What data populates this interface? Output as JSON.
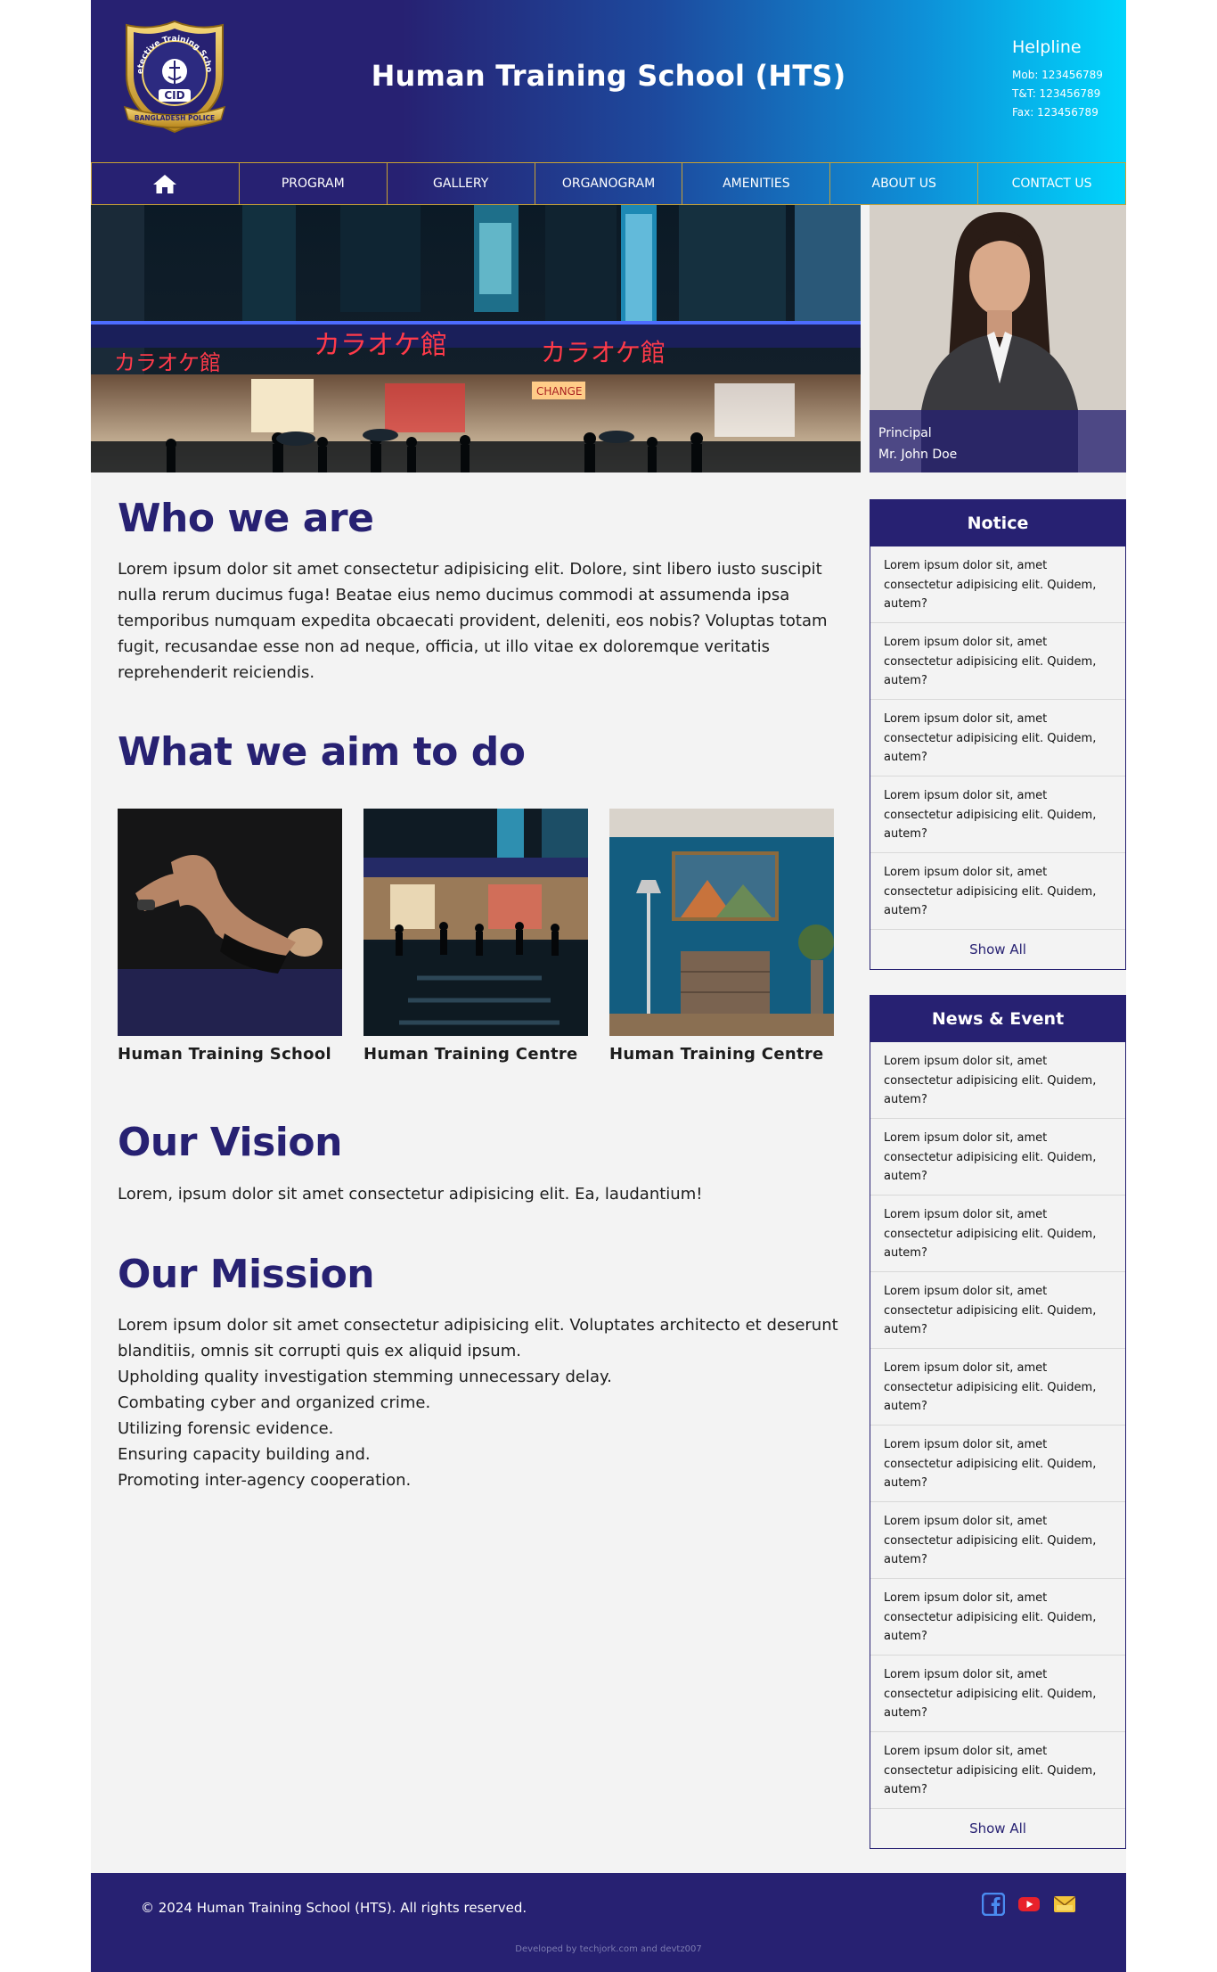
{
  "header": {
    "logo_text": [
      "Detective Training School",
      "CID",
      "BANGLADESH POLICE"
    ],
    "title": "Human Training School (HTS)",
    "helpline": {
      "title": "Helpline",
      "lines": [
        "Mob: 123456789",
        "T&T: 123456789",
        "Fax: 123456789"
      ]
    }
  },
  "nav": {
    "home_icon": "home-icon",
    "items": [
      "PROGRAM",
      "GALLERY",
      "ORGANOGRAM",
      "AMENITIES",
      "ABOUT US",
      "CONTACT US"
    ]
  },
  "hero": {
    "main_sign": [
      "カラオケ館",
      "カラオケ館",
      "カラオケ館",
      "CHANGE"
    ],
    "principal": {
      "role": "Principal",
      "name": "Mr. John Doe"
    }
  },
  "who": {
    "title": "Who we are",
    "text": "Lorem ipsum dolor sit amet consectetur adipisicing elit. Dolore, sint libero iusto suscipit nulla rerum ducimus fuga! Beatae eius nemo ducimus commodi at assumenda ipsa temporibus numquam expedita obcaecati provident, deleniti, eos nobis? Voluptas totam fugit, recusandae esse non ad neque, officia, ut illo vitae ex doloremque veritatis reprehenderit reiciendis."
  },
  "aim": {
    "title": "What we aim to do",
    "cards": [
      {
        "caption": "Human Training School"
      },
      {
        "caption": "Human Training Centre"
      },
      {
        "caption": "Human Training Centre"
      }
    ]
  },
  "vision": {
    "title": "Our Vision",
    "text": "Lorem, ipsum dolor sit amet consectetur adipisicing elit. Ea, laudantium!"
  },
  "mission": {
    "title": "Our Mission",
    "lines": [
      "Lorem ipsum dolor sit amet consectetur adipisicing elit. Voluptates architecto et deserunt blanditiis, omnis sit corrupti quis ex aliquid ipsum.",
      "Upholding quality investigation stemming unnecessary delay.",
      "Combating cyber and organized crime.",
      "Utilizing forensic evidence.",
      "Ensuring capacity building and.",
      "Promoting inter-agency cooperation."
    ]
  },
  "notice": {
    "title": "Notice",
    "items": [
      "Lorem ipsum dolor sit, amet consectetur adipisicing elit. Quidem, autem?",
      "Lorem ipsum dolor sit, amet consectetur adipisicing elit. Quidem, autem?",
      "Lorem ipsum dolor sit, amet consectetur adipisicing elit. Quidem, autem?",
      "Lorem ipsum dolor sit, amet consectetur adipisicing elit. Quidem, autem?",
      "Lorem ipsum dolor sit, amet consectetur adipisicing elit. Quidem, autem?"
    ],
    "show_all": "Show All"
  },
  "news": {
    "title": "News & Event",
    "items": [
      "Lorem ipsum dolor sit, amet consectetur adipisicing elit. Quidem, autem?",
      "Lorem ipsum dolor sit, amet consectetur adipisicing elit. Quidem, autem?",
      "Lorem ipsum dolor sit, amet consectetur adipisicing elit. Quidem, autem?",
      "Lorem ipsum dolor sit, amet consectetur adipisicing elit. Quidem, autem?",
      "Lorem ipsum dolor sit, amet consectetur adipisicing elit. Quidem, autem?",
      "Lorem ipsum dolor sit, amet consectetur adipisicing elit. Quidem, autem?",
      "Lorem ipsum dolor sit, amet consectetur adipisicing elit. Quidem, autem?",
      "Lorem ipsum dolor sit, amet consectetur adipisicing elit. Quidem, autem?",
      "Lorem ipsum dolor sit, amet consectetur adipisicing elit. Quidem, autem?",
      "Lorem ipsum dolor sit, amet consectetur adipisicing elit. Quidem, autem?"
    ],
    "show_all": "Show All"
  },
  "footer": {
    "copyright": "© 2024 Human Training School (HTS). All rights reserved.",
    "credits": "Developed by techjork.com and devtz007",
    "social_icons": [
      "facebook-icon",
      "youtube-icon",
      "email-icon"
    ]
  },
  "colors": {
    "brand_navy": "#272172",
    "brand_cyan": "#00d5fc",
    "nav_border_gold": "#c9a233",
    "page_bg": "#f3f3f3"
  }
}
